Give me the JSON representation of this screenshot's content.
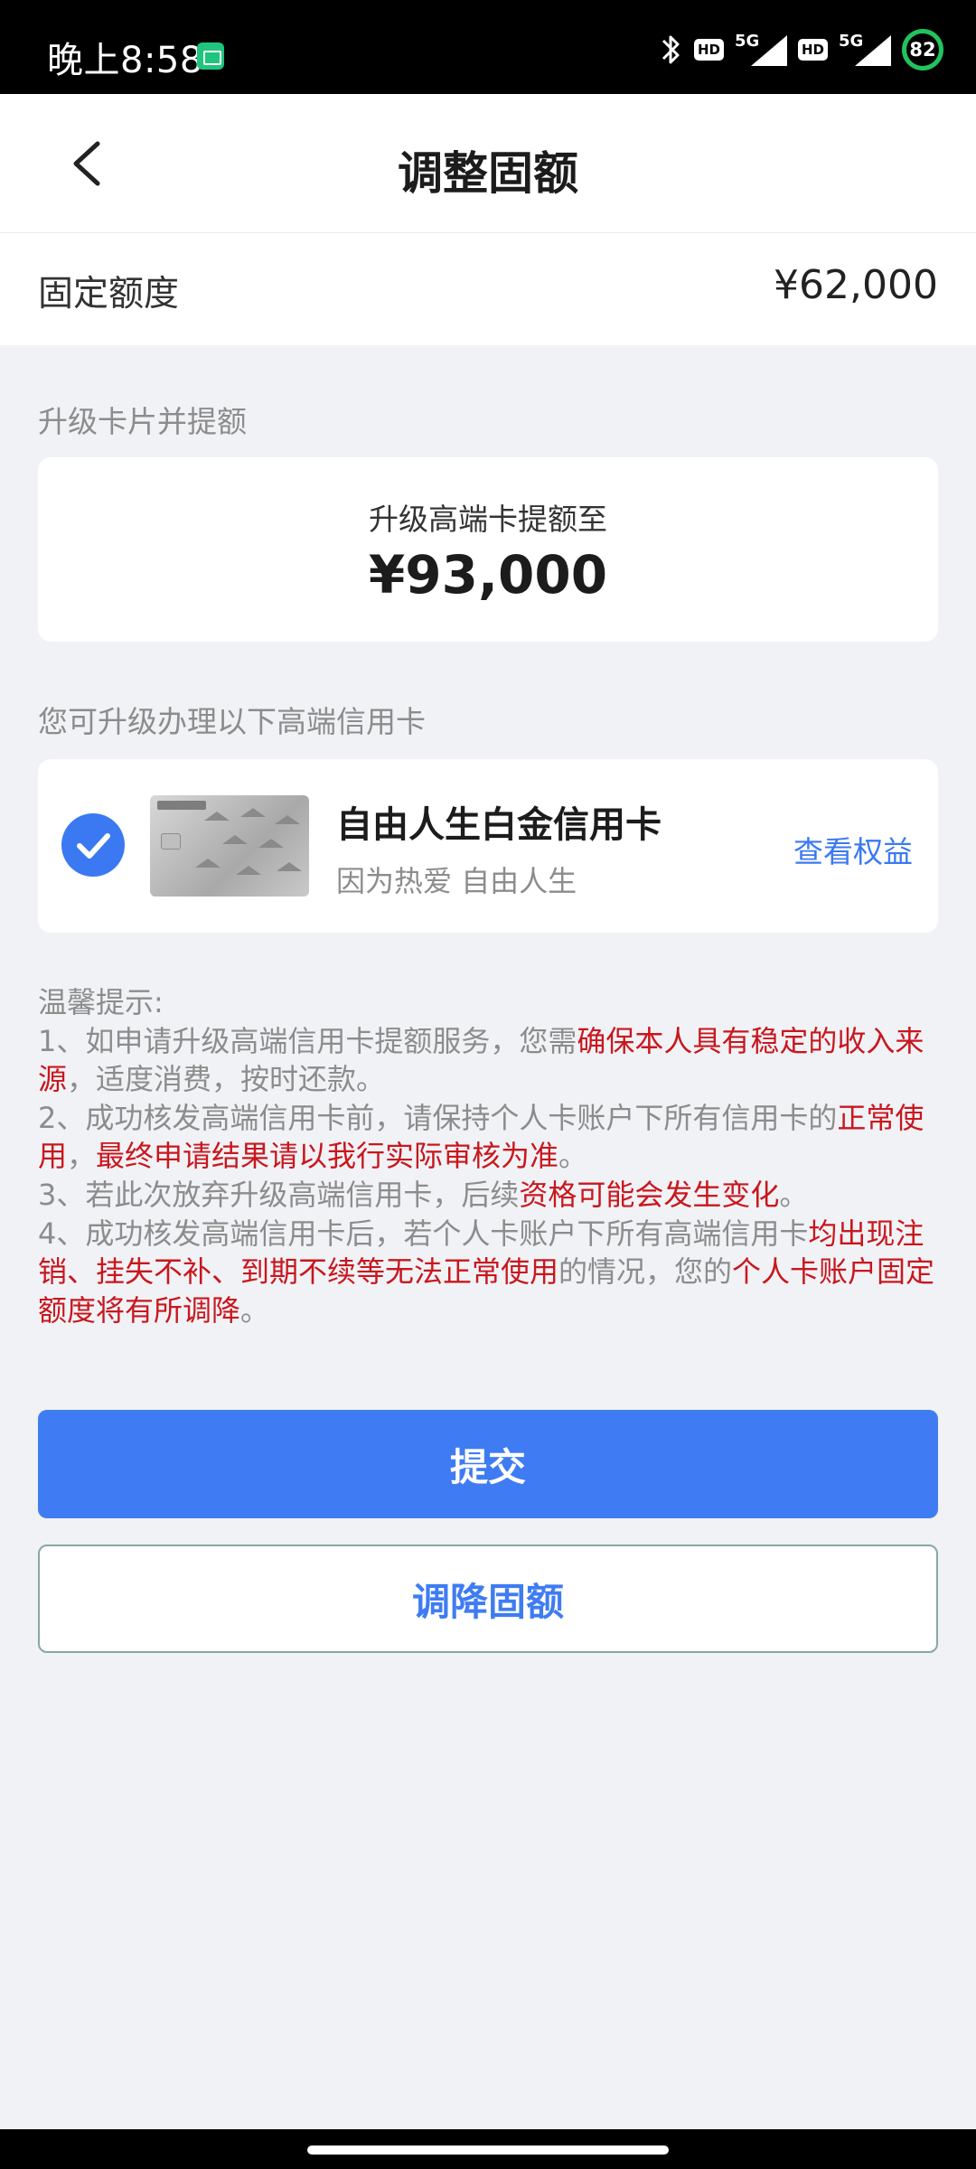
{
  "status_bar": {
    "time": "晚上8:58",
    "hd1": "HD",
    "net1": "5G",
    "hd2": "HD",
    "net2": "5G",
    "battery": "82"
  },
  "header": {
    "title": "调整固额"
  },
  "quota": {
    "label": "固定额度",
    "value": "¥62,000"
  },
  "upgrade": {
    "section_label": "升级卡片并提额",
    "subtitle": "升级高端卡提额至",
    "amount": "¥93,000"
  },
  "cards": {
    "section_label": "您可升级办理以下高端信用卡",
    "items": [
      {
        "name": "自由人生白金信用卡",
        "slogan": "因为热爱 自由人生",
        "link": "查看权益",
        "selected": true
      }
    ]
  },
  "tips": {
    "title": "温馨提示:",
    "t1_a": "1、如申请升级高端信用卡提额服务，您需",
    "t1_b": "确保本人具有稳定的收入来源",
    "t1_c": "，适度消费，按时还款。",
    "t2_a": "2、成功核发高端信用卡前，请保持个人卡账户下所有信用卡的",
    "t2_b": "正常使用",
    "t2_c": "，",
    "t2_d": "最终申请结果请以我行实际审核为准",
    "t2_e": "。",
    "t3_a": "3、若此次放弃升级高端信用卡，后续",
    "t3_b": "资格可能会发生变化",
    "t3_c": "。",
    "t4_a": "4、成功核发高端信用卡后，若个人卡账户下所有高端信用卡",
    "t4_b": "均出现注销、挂失不补、到期不续等无法正常使用",
    "t4_c": "的情况，您的",
    "t4_d": "个人卡账户固定额度将有所调降",
    "t4_e": "。"
  },
  "buttons": {
    "submit": "提交",
    "lower": "调降固额"
  },
  "colors": {
    "primary": "#3f7cf3",
    "highlight": "#c8171d",
    "background": "#f1f2f6"
  }
}
